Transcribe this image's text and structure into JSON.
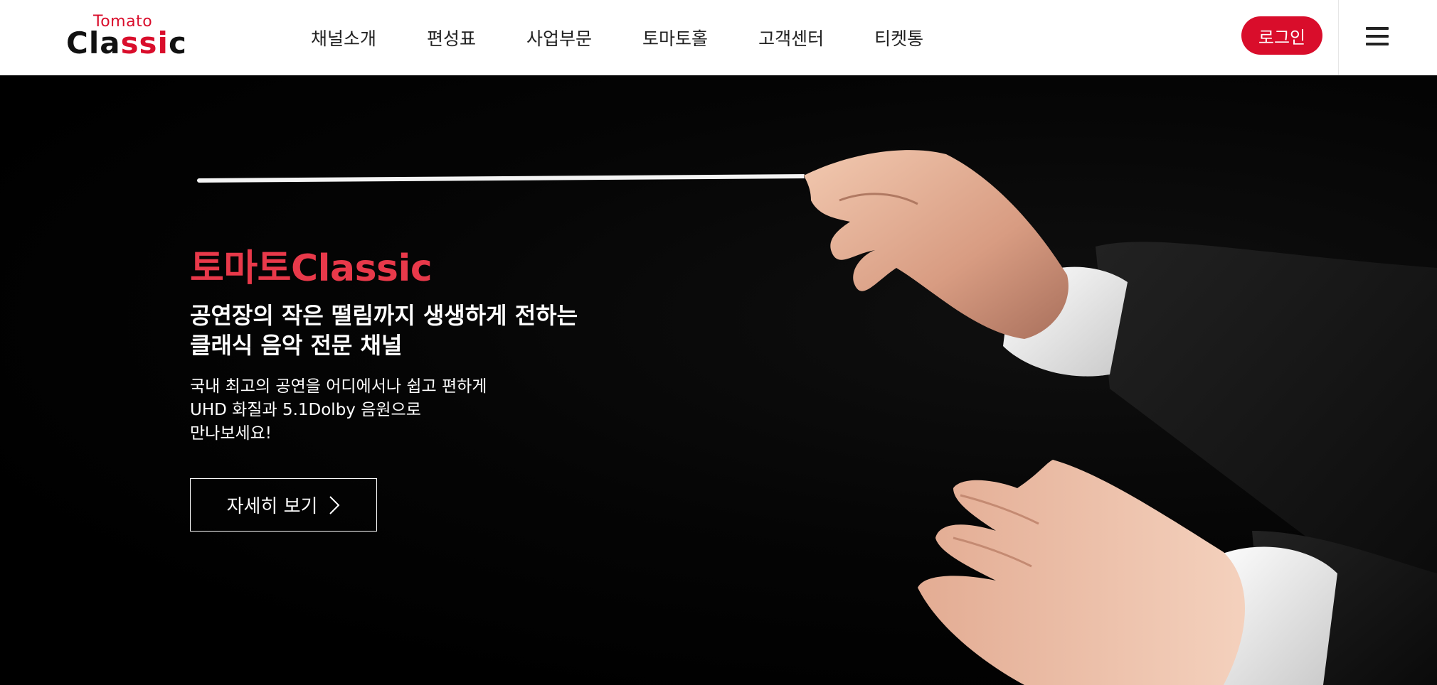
{
  "header": {
    "logo": {
      "top": "Tomato",
      "main_prefix": "Cla",
      "main_accent": "ssi",
      "main_suffix": "c"
    },
    "nav": [
      "채널소개",
      "편성표",
      "사업부문",
      "토마토홀",
      "고객센터",
      "티켓통"
    ],
    "login_label": "로그인",
    "menu_icon": "hamburger-menu-icon"
  },
  "hero": {
    "title": "토마토Classic",
    "subtitle_line1": "공연장의 작은 떨림까지 생생하게 전하는",
    "subtitle_line2": "클래식 음악 전문 채널",
    "desc_line1": "국내 최고의 공연을 어디에서나 쉽고 편하게",
    "desc_line2": "UHD 화질과 5.1Dolby 음원으로",
    "desc_line3": "만나보세요!",
    "button_label": "자세히 보기",
    "button_icon": "chevron-right-icon"
  },
  "colors": {
    "accent": "#d90d2b",
    "title_red": "#e8394a",
    "background": "#000000",
    "header_bg": "#ffffff"
  }
}
